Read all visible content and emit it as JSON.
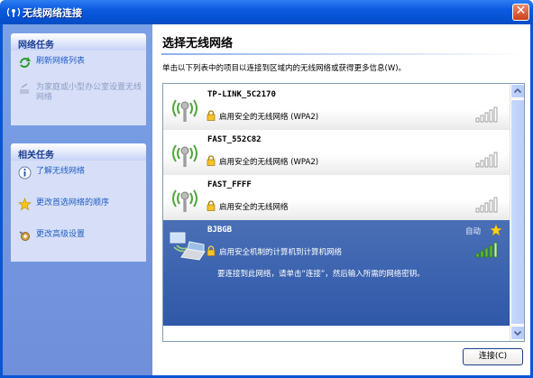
{
  "window": {
    "title": "无线网络连接",
    "close_glyph": "✕"
  },
  "sidebar": {
    "network_tasks": {
      "title": "网络任务",
      "items": [
        {
          "label": "刷新网络列表",
          "icon": "refresh-icon",
          "enabled": true
        },
        {
          "label": "为家庭或小型办公室设置无线网络",
          "icon": "setup-wizard-icon",
          "enabled": false
        }
      ]
    },
    "related_tasks": {
      "title": "相关任务",
      "items": [
        {
          "label": "了解无线网络",
          "icon": "info-icon"
        },
        {
          "label": "更改首选网络的顺序",
          "icon": "star-icon"
        },
        {
          "label": "更改高级设置",
          "icon": "settings-icon"
        }
      ]
    }
  },
  "main": {
    "heading": "选择无线网络",
    "description": "单击以下列表中的项目以连接到区域内的无线网络或获得更多信息(W)。",
    "networks": [
      {
        "name": "TP-LINK_5C2170",
        "security": "启用安全的无线网络 (WPA2)",
        "signal": 4
      },
      {
        "name": "FAST_552C82",
        "security": "启用安全的无线网络 (WPA2)",
        "signal": 4
      },
      {
        "name": "FAST_FFFF",
        "security": "启用安全的无线网络",
        "signal": 4
      },
      {
        "name": "BJBGB",
        "security": "启用安全机制的计算机到计算机网络",
        "hint": "要连接到此网络，请单击“连接”，然后输入所需的网络密钥。",
        "auto": "自动",
        "signal": 4,
        "selected": true
      }
    ],
    "connect_button": "连接(C)"
  },
  "colors": {
    "title_bar": "#0a55d6",
    "task_pane": "#7aa1e6",
    "selected_row": "#2f58a8",
    "signal_bar": "#5fbf32"
  }
}
